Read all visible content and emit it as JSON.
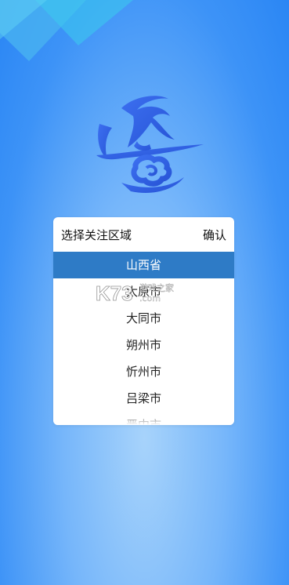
{
  "picker": {
    "title": "选择关注区域",
    "confirm_label": "确认",
    "items": [
      {
        "label": "山西省",
        "selected": true
      },
      {
        "label": "太原市",
        "selected": false
      },
      {
        "label": "大同市",
        "selected": false
      },
      {
        "label": "朔州市",
        "selected": false
      },
      {
        "label": "忻州市",
        "selected": false
      },
      {
        "label": "吕梁市",
        "selected": false
      },
      {
        "label": "晋中市",
        "selected": false
      }
    ]
  },
  "watermark": {
    "brand": "K73",
    "cn": "游戏之家",
    "domain": ".com"
  },
  "colors": {
    "selected_row": "#2e7bc6",
    "background_top": "#2a86f4",
    "background_bottom": "#a7d3fb"
  },
  "icons": {
    "logo": "brush-stroke-logo-icon"
  }
}
